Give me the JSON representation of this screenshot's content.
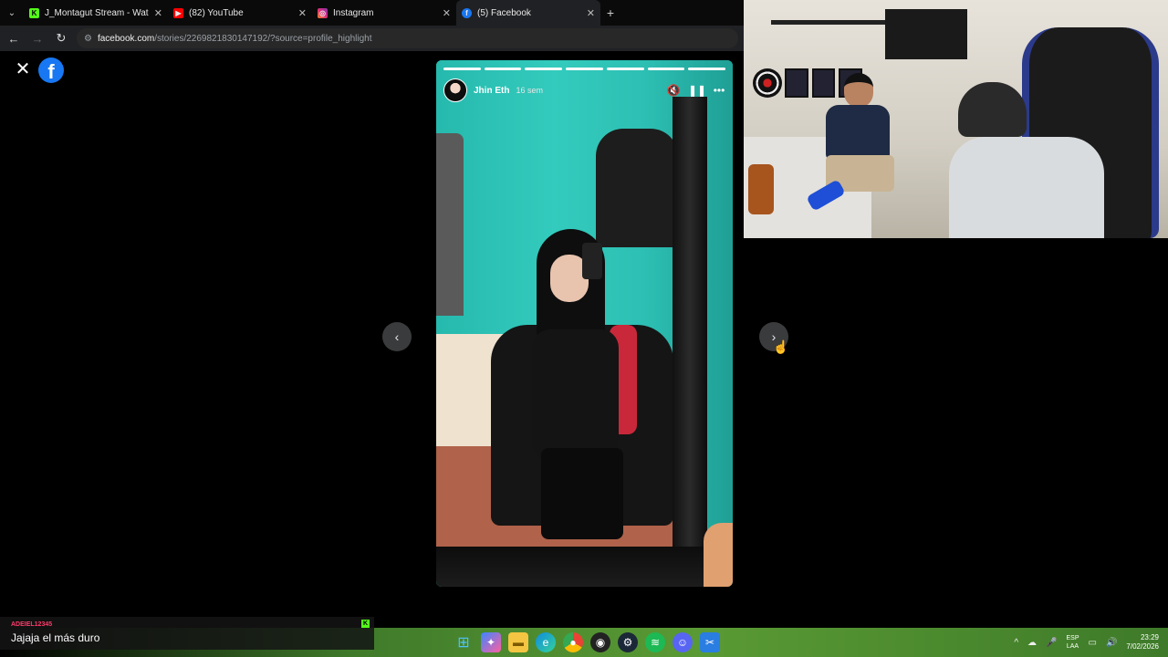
{
  "browser": {
    "tabs": [
      {
        "title": "J_Montagut Stream - Watch Liv",
        "icon": "kick-icon",
        "color": "#53fc18",
        "active": false
      },
      {
        "title": "(82) YouTube",
        "icon": "youtube-icon",
        "color": "#ff0000",
        "active": false
      },
      {
        "title": "Instagram",
        "icon": "instagram-icon",
        "color": "#e1306c",
        "active": false
      },
      {
        "title": "(5) Facebook",
        "icon": "facebook-icon",
        "color": "#1877f2",
        "active": true
      }
    ],
    "url_domain": "facebook.com",
    "url_path": "/stories/2269821830147192/?source=profile_highlight"
  },
  "story": {
    "author": "Jhin Eth",
    "time": "16 sem",
    "progress_total": 7,
    "progress_done": 7
  },
  "chat": {
    "username": "ADEIEL12345",
    "message": "Jajaja el más duro"
  },
  "taskbar": {
    "apps": [
      "windows-start-icon",
      "copilot-icon",
      "file-explorer-icon",
      "edge-icon",
      "chrome-icon",
      "obs-icon",
      "steam-icon",
      "spotify-icon",
      "discord-icon",
      "snipping-tool-icon"
    ],
    "lang_top": "ESP",
    "lang_bottom": "LAA",
    "time": "23:29",
    "date": "7/02/2026"
  }
}
